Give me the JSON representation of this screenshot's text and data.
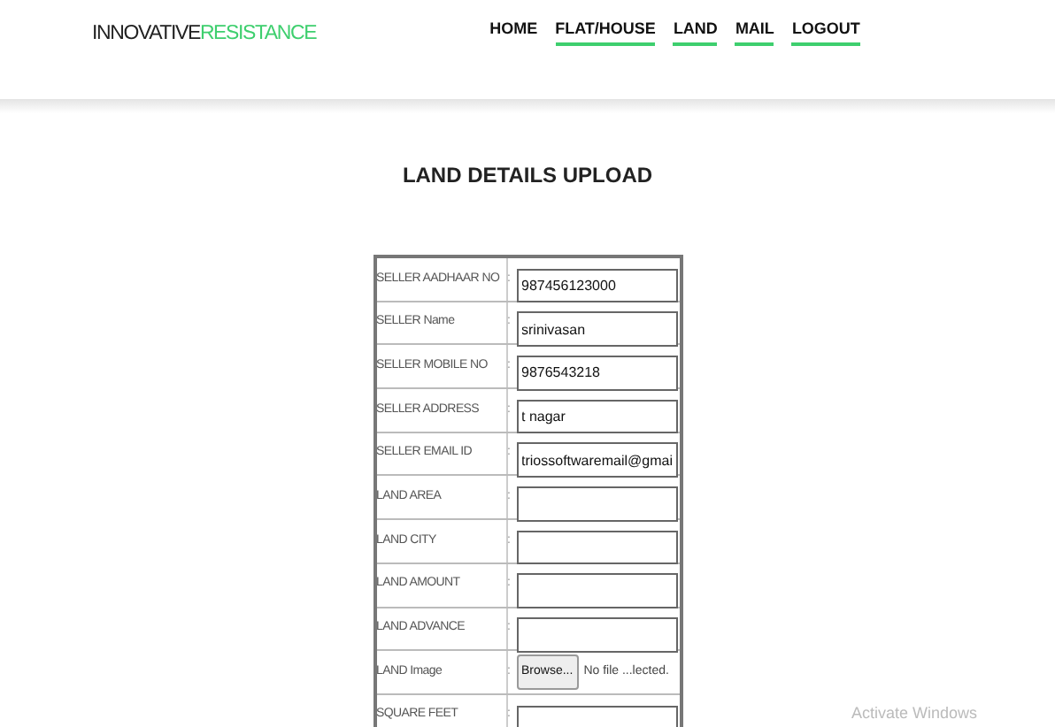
{
  "logo": {
    "text": "INNOVATIVE",
    "accent": "RESISTANCE"
  },
  "nav": [
    {
      "label": "HOME",
      "underlined": false
    },
    {
      "label": "FLAT/HOUSE",
      "underlined": true
    },
    {
      "label": "LAND",
      "underlined": true
    },
    {
      "label": "MAIL",
      "underlined": true
    },
    {
      "label": "LOGOUT",
      "underlined": true
    }
  ],
  "title": "LAND DETAILS UPLOAD",
  "form": {
    "separator": ":",
    "rows": [
      {
        "label": "SELLER AADHAAR NO",
        "kind": "text",
        "value": "987456123000"
      },
      {
        "label": "SELLER Name",
        "kind": "text",
        "value": "srinivasan"
      },
      {
        "label": "SELLER MOBILE NO",
        "kind": "text",
        "value": "9876543218"
      },
      {
        "label": "SELLER ADDRESS",
        "kind": "text",
        "value": "t nagar"
      },
      {
        "label": "SELLER EMAIL ID",
        "kind": "text",
        "value": "triossoftwaremail@gmai"
      },
      {
        "label": "LAND AREA",
        "kind": "text"
      },
      {
        "label": "LAND CITY",
        "kind": "text"
      },
      {
        "label": "LAND AMOUNT",
        "kind": "text"
      },
      {
        "label": "LAND ADVANCE",
        "kind": "text"
      },
      {
        "label": "LAND Image",
        "kind": "file",
        "button": "Browse...",
        "file_status": "No file ...lected."
      },
      {
        "label": "SQUARE FEET",
        "kind": "text"
      }
    ]
  },
  "os_notice": "Activate Windows"
}
